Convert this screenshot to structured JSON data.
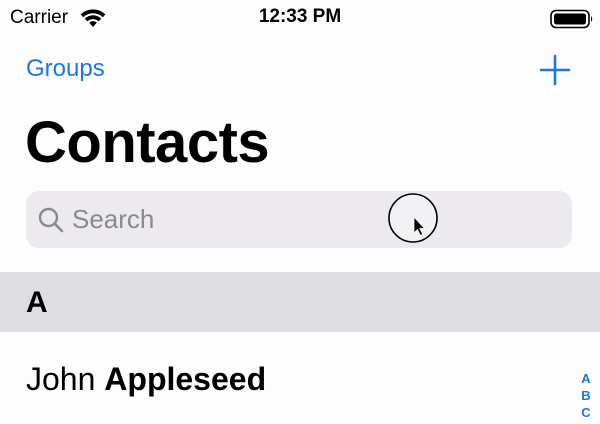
{
  "status_bar": {
    "carrier": "Carrier",
    "time": "12:33 PM",
    "icons": [
      "wifi-icon",
      "battery-icon"
    ]
  },
  "nav": {
    "left_button": "Groups",
    "right_button_icon": "plus-icon"
  },
  "title": "Contacts",
  "search": {
    "placeholder": "Search",
    "value": "",
    "icon": "search-icon"
  },
  "sections": [
    {
      "letter": "A",
      "contacts": [
        {
          "first_name": "John",
          "last_name": "Appleseed"
        }
      ]
    }
  ],
  "index": [
    "A",
    "B",
    "C"
  ],
  "colors": {
    "accent": "#1a78e6",
    "section_header_bg": "#dedde2",
    "search_bg": "#eceaee",
    "placeholder": "#8a898e"
  }
}
